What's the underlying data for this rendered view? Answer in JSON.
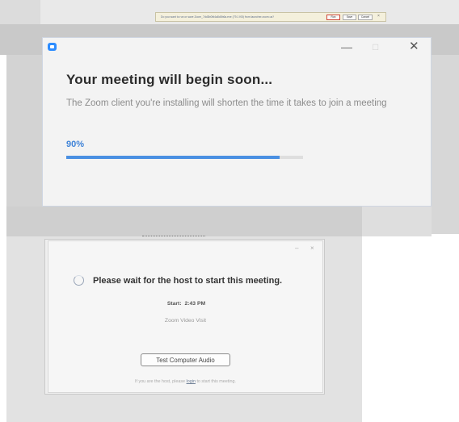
{
  "download_bar": {
    "text": "Do you want to run or save Zoom_7dd3b0fd4a8d0b6a.exe (79.1 KB) from launcher.zoom.us?",
    "run_label": "Run",
    "save_label": "Save",
    "cancel_label": "Cancel",
    "close_label": "×"
  },
  "installer_window": {
    "title": "Your meeting will begin soon...",
    "description": "The Zoom client you're installing will shorten the time it takes to join a meeting",
    "progress_label": "90%",
    "progress_value": 0.9,
    "minimize_glyph": "—",
    "maximize_glyph": "□",
    "close_glyph": "✕"
  },
  "waiting_dialog": {
    "message": "Please wait for the host to start this meeting.",
    "start_label": "Start:",
    "start_time": "2:43 PM",
    "meeting_name": "Zoom Video Visit",
    "test_audio_label": "Test Computer Audio",
    "host_note_prefix": "If you are the host, please",
    "host_login_link": "login",
    "host_note_suffix": "to start this meeting.",
    "minimize_glyph": "–",
    "close_glyph": "×"
  },
  "colors": {
    "accent": "#2d8cff",
    "progress": "#4a90e2",
    "percent_text": "#3f83d8"
  },
  "icons": {
    "app_logo": "zoom-logo-icon",
    "spinner": "loading-spinner-icon"
  }
}
